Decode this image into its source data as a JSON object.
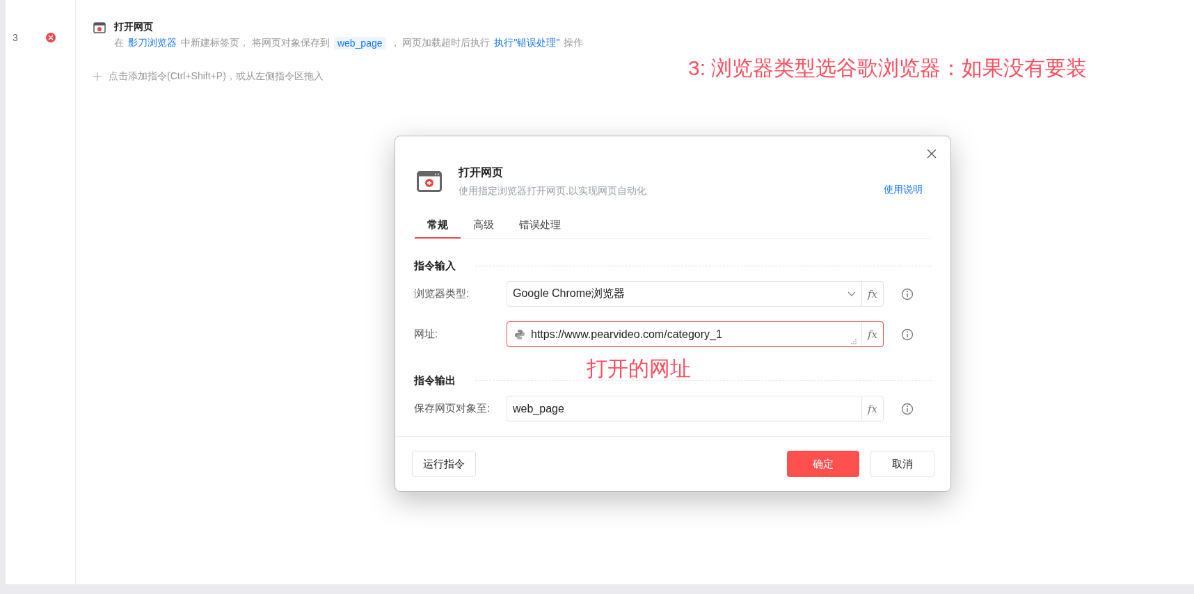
{
  "editor": {
    "lines": [
      {
        "number": "3",
        "error": true,
        "title": "打开网页",
        "description": [
          {
            "kind": "text",
            "text": "在"
          },
          {
            "kind": "link",
            "text": "影刀浏览器"
          },
          {
            "kind": "text",
            "text": "中新建标签页，  将网页对象保存到"
          },
          {
            "kind": "variable",
            "text": "web_page"
          },
          {
            "kind": "text",
            "text": "，  网页加载超时后执行"
          },
          {
            "kind": "link",
            "text": "执行\"错误处理\""
          },
          {
            "kind": "text",
            "text": "操作"
          }
        ]
      }
    ],
    "add_hint": "点击添加指令(Ctrl+Shift+P)，或从左侧指令区拖入"
  },
  "annotations": [
    {
      "text": "3: 浏览器类型选谷歌浏览器：如果没有要装"
    },
    {
      "text": "打开的网址"
    }
  ],
  "dialog": {
    "title": "打开网页",
    "subtitle": "使用指定浏览器打开网页,以实现网页自动化",
    "help_link": "使用说明",
    "tabs": [
      {
        "label": "常规",
        "selected": true
      },
      {
        "label": "高级",
        "selected": false
      },
      {
        "label": "错误处理",
        "selected": false
      }
    ],
    "sections": [
      {
        "title": "指令输入",
        "fields": [
          {
            "label": "浏览器类型:",
            "kind": "select",
            "value": "Google Chrome浏览器",
            "focused": false,
            "formula_button": "fx"
          },
          {
            "label": "网址:",
            "kind": "code",
            "value": "https://www.pearvideo.com/category_1",
            "focused": true,
            "formula_button": "fx"
          }
        ]
      },
      {
        "title": "指令输出",
        "fields": [
          {
            "label": "保存网页对象至:",
            "kind": "text",
            "value": "web_page",
            "focused": false,
            "formula_button": "fx"
          }
        ]
      }
    ],
    "buttons": [
      {
        "label": "运行指令",
        "kind": "secondary"
      },
      {
        "label": "确定",
        "kind": "primary"
      },
      {
        "label": "取消",
        "kind": "secondary"
      }
    ]
  }
}
